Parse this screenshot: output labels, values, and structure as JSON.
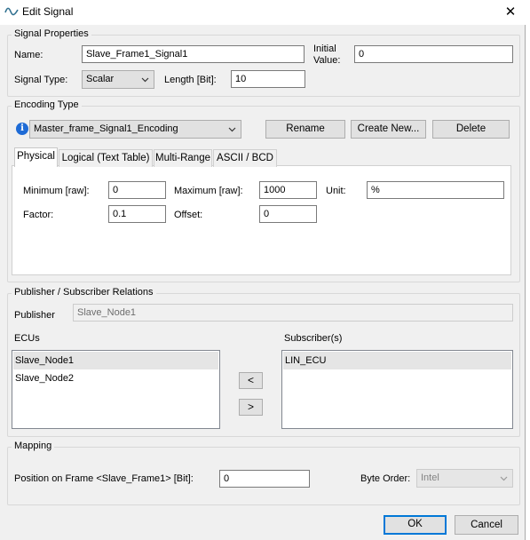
{
  "window": {
    "title": "Edit Signal",
    "close_glyph": "✕",
    "icon": "signal-wave-icon"
  },
  "signal_properties": {
    "legend": "Signal Properties",
    "name_label": "Name:",
    "name_value": "Slave_Frame1_Signal1",
    "initial_value_label_line1": "Initial",
    "initial_value_label_line2": "Value:",
    "initial_value": "0",
    "signal_type_label": "Signal Type:",
    "signal_type_value": "Scalar",
    "length_label": "Length [Bit]:",
    "length_value": "10"
  },
  "encoding_type": {
    "legend": "Encoding Type",
    "info_icon": "info-icon",
    "encoding_value": "Master_frame_Signal1_Encoding",
    "rename_label": "Rename",
    "create_new_label": "Create New...",
    "delete_label": "Delete",
    "tabs": [
      "Physical",
      "Logical (Text Table)",
      "Multi-Range",
      "ASCII / BCD"
    ],
    "active_tab": "Physical",
    "physical": {
      "minimum_label": "Minimum [raw]:",
      "minimum_value": "0",
      "maximum_label": "Maximum [raw]:",
      "maximum_value": "1000",
      "unit_label": "Unit:",
      "unit_value": "%",
      "factor_label": "Factor:",
      "factor_value": "0.1",
      "offset_label": "Offset:",
      "offset_value": "0"
    }
  },
  "relations": {
    "legend": "Publisher / Subscriber Relations",
    "publisher_label": "Publisher",
    "publisher_value": "Slave_Node1",
    "ecus_label": "ECUs",
    "ecus": [
      "Slave_Node1",
      "Slave_Node2"
    ],
    "subscribers_label": "Subscriber(s)",
    "subscribers": [
      "LIN_ECU"
    ],
    "move_left_label": "<",
    "move_right_label": ">"
  },
  "mapping": {
    "legend": "Mapping",
    "position_label": "Position on Frame <Slave_Frame1> [Bit]:",
    "position_value": "0",
    "byte_order_label": "Byte Order:",
    "byte_order_value": "Intel"
  },
  "footer": {
    "ok_label": "OK",
    "cancel_label": "Cancel"
  },
  "colors": {
    "accent": "#0078d7",
    "info_blue": "#1e6bd6",
    "dialog_bg": "#f0f0f0"
  }
}
